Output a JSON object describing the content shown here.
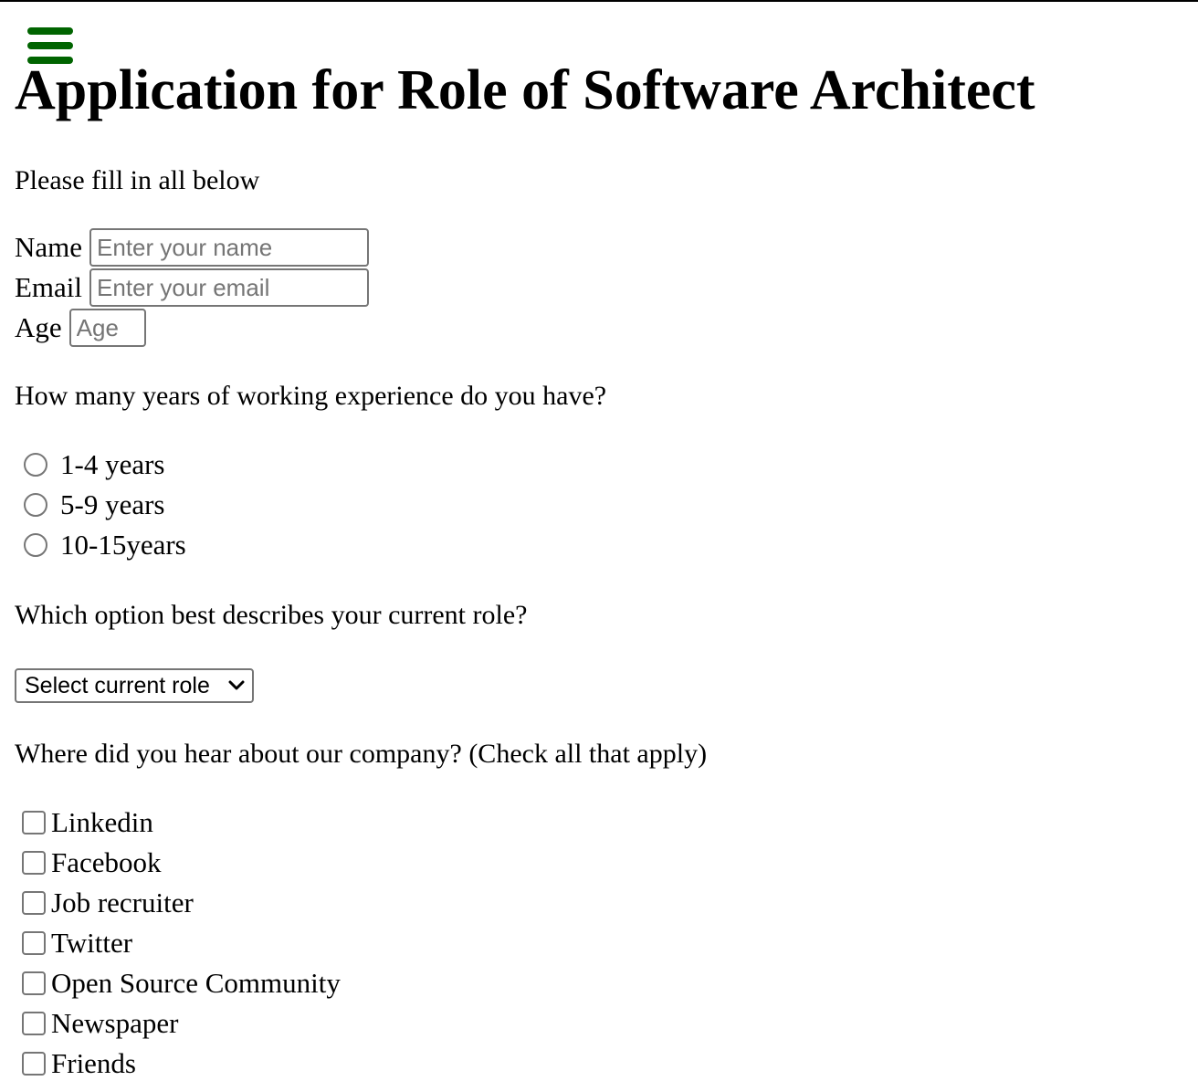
{
  "header": {
    "menu_icon": "hamburger-menu-icon",
    "menu_color": "#006400",
    "title": "Application for Role of Software Architect"
  },
  "form": {
    "intro": "Please fill in all below",
    "fields": {
      "name": {
        "label": "Name",
        "placeholder": "Enter your name",
        "value": ""
      },
      "email": {
        "label": "Email",
        "placeholder": "Enter your email",
        "value": ""
      },
      "age": {
        "label": "Age",
        "placeholder": "Age",
        "value": ""
      }
    },
    "experience": {
      "question": "How many years of working experience do you have?",
      "options": [
        "1-4 years",
        "5-9 years",
        "10-15years"
      ]
    },
    "role": {
      "question": "Which option best describes your current role?",
      "selected": "Select current role",
      "icon": "chevron-down-icon"
    },
    "source": {
      "question": "Where did you hear about our company? (Check all that apply)",
      "options": [
        "Linkedin",
        "Facebook",
        "Job recruiter",
        "Twitter",
        "Open Source Community",
        "Newspaper",
        "Friends"
      ]
    }
  }
}
